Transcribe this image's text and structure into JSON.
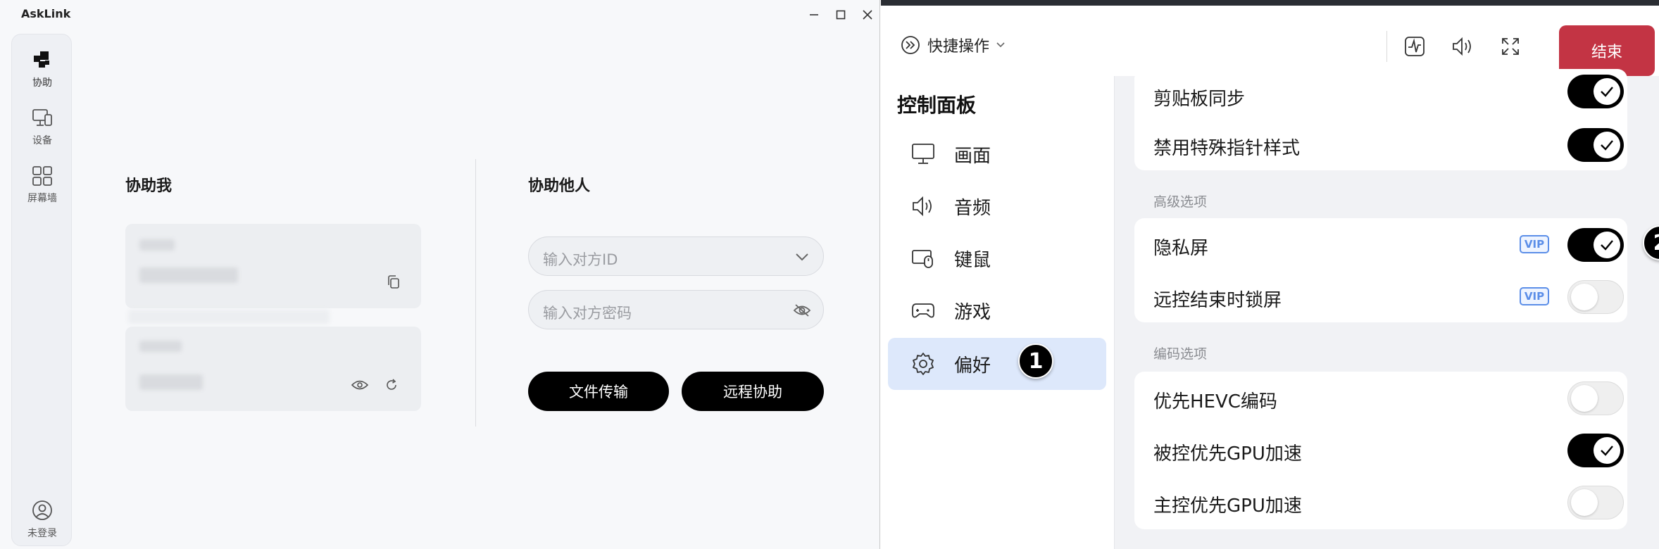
{
  "left_app": {
    "title": "AskLink",
    "rail": [
      {
        "label": "协助",
        "icon": "assist-icon"
      },
      {
        "label": "设备",
        "icon": "device-icon"
      },
      {
        "label": "屏幕墙",
        "icon": "screen-wall-icon"
      }
    ],
    "account_label": "未登录",
    "help_me": {
      "title": "协助我"
    },
    "help_others": {
      "title": "协助他人",
      "id_placeholder": "输入对方ID",
      "password_placeholder": "输入对方密码",
      "file_transfer_label": "文件传输",
      "remote_assist_label": "远程协助"
    }
  },
  "remote_panel": {
    "toolbar": {
      "quick_actions_label": "快捷操作",
      "icons": [
        "stats-icon",
        "volume-icon",
        "fullscreen-icon"
      ],
      "end_label": "结束",
      "end_color": "#c33444"
    },
    "control_panel": {
      "title": "控制面板",
      "items": [
        {
          "label": "画面",
          "icon": "monitor-icon"
        },
        {
          "label": "音频",
          "icon": "speaker-icon"
        },
        {
          "label": "键鼠",
          "icon": "keyboard-mouse-icon"
        },
        {
          "label": "游戏",
          "icon": "gamepad-icon"
        },
        {
          "label": "偏好",
          "icon": "gear-icon",
          "active": true
        }
      ],
      "active_color": "#dde8fb"
    },
    "settings": {
      "general": [
        {
          "label": "剪贴板同步",
          "on": true
        },
        {
          "label": "禁用特殊指针样式",
          "on": true
        }
      ],
      "advanced_caption": "高级选项",
      "advanced": [
        {
          "label": "隐私屏",
          "vip": "VIP",
          "on": true
        },
        {
          "label": "远控结束时锁屏",
          "vip": "VIP",
          "on": false
        }
      ],
      "encoding_caption": "编码选项",
      "encoding": [
        {
          "label": "优先HEVC编码",
          "on": false
        },
        {
          "label": "被控优先GPU加速",
          "on": true
        },
        {
          "label": "主控优先GPU加速",
          "on": false
        }
      ]
    },
    "markers": [
      "1",
      "2"
    ]
  }
}
